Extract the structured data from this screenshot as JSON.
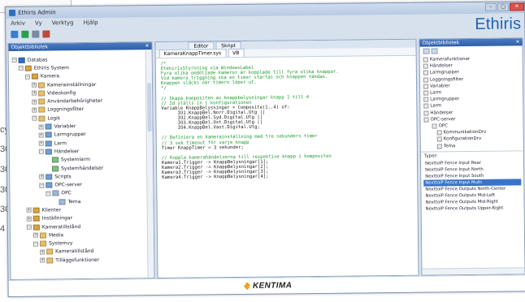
{
  "window": {
    "title": "Ethiris Admin",
    "controls": [
      "–",
      "□",
      "✕"
    ]
  },
  "menu": [
    "Arkiv",
    "Vy",
    "Verktyg",
    "Hjälp"
  ],
  "brand": "Ethiris",
  "background_fragments": [
    "cy",
    "30",
    "30",
    "30",
    "30",
    "4"
  ],
  "left_panel": {
    "header": "Objektbibliotek",
    "tree": [
      {
        "label": "Databas",
        "indent": 0,
        "color": "#2f6fc2",
        "expander": "−"
      },
      {
        "label": "Ethiris System",
        "indent": 1,
        "color": "#d9a441",
        "expander": "−"
      },
      {
        "label": "Kamera",
        "indent": 2,
        "color": "#d9a441",
        "expander": "−"
      },
      {
        "label": "Kamerainställningar",
        "indent": 3,
        "color": "#e9c06a",
        "expander": "+"
      },
      {
        "label": "Videokonfig",
        "indent": 3,
        "color": "#e9c06a",
        "expander": "+"
      },
      {
        "label": "Användarbehörigheter",
        "indent": 3,
        "color": "#e9c06a",
        "expander": "+"
      },
      {
        "label": "Loggningsfilter",
        "indent": 3,
        "color": "#e9c06a",
        "expander": "+"
      },
      {
        "label": "Logik",
        "indent": 3,
        "color": "#e9c06a",
        "expander": "−"
      },
      {
        "label": "Variabler",
        "indent": 4,
        "color": "#6fa0d8",
        "expander": "+"
      },
      {
        "label": "Larmgrupper",
        "indent": 4,
        "color": "#6fa0d8",
        "expander": "+"
      },
      {
        "label": "Larm",
        "indent": 4,
        "color": "#6fa0d8",
        "expander": "+"
      },
      {
        "label": "Händelser",
        "indent": 4,
        "color": "#6fa0d8",
        "expander": "−"
      },
      {
        "label": "Systemlarm",
        "indent": 5,
        "color": "#7fc080",
        "expander": ""
      },
      {
        "label": "Systemhändelser",
        "indent": 5,
        "color": "#7fc080",
        "expander": ""
      },
      {
        "label": "Scripts",
        "indent": 4,
        "color": "#6fa0d8",
        "expander": "+"
      },
      {
        "label": "OPC-server",
        "indent": 4,
        "color": "#6fa0d8",
        "expander": "−"
      },
      {
        "label": "OPC",
        "indent": 5,
        "color": "#9fb7d8",
        "expander": "−"
      },
      {
        "label": "Tema",
        "indent": 6,
        "color": "#9fb7d8",
        "expander": ""
      },
      {
        "label": "Klienter",
        "indent": 2,
        "color": "#d9a441",
        "expander": "+"
      },
      {
        "label": "Inställningar",
        "indent": 2,
        "color": "#d9a441",
        "expander": "+"
      },
      {
        "label": "Kameratillstånd",
        "indent": 2,
        "color": "#d9a441",
        "expander": "−"
      },
      {
        "label": "Media",
        "indent": 3,
        "color": "#e9c06a",
        "expander": "+"
      },
      {
        "label": "Systemvy",
        "indent": 3,
        "color": "#e9c06a",
        "expander": "−"
      },
      {
        "label": "Kameratillstånd",
        "indent": 4,
        "color": "#e9c06a",
        "expander": "+"
      },
      {
        "label": "Tilläggsfunktioner",
        "indent": 4,
        "color": "#e9c06a",
        "expander": "+"
      }
    ]
  },
  "center": {
    "doc_tabs": [
      "Editor",
      "Skript"
    ],
    "file_tabs": [
      "KameraKnappTimer.sys",
      "VB"
    ],
    "code": [
      {
        "t": "/*",
        "c": "g"
      },
      {
        "t": "EtehirisStyrnning via WindowsLabel",
        "c": "g"
      },
      {
        "t": "Fyra olika omdöljade kameror är kopplade till fyra olika knappar.",
        "c": "g"
      },
      {
        "t": "Vid kamera triggning ska en timer startas och knappen tändas.",
        "c": "g"
      },
      {
        "t": "Knappen släcks när timern löper ut.",
        "c": "g"
      },
      {
        "t": "*/",
        "c": "g"
      },
      {
        "t": "",
        "c": "k"
      },
      {
        "t": "// Skapa kompositen av knappbelysningar knapp 1 till 4",
        "c": "g"
      },
      {
        "t": "// Id ställs in i konfigurationen",
        "c": "g"
      },
      {
        "t": "Variable KnappBelysningar = Composite(1..4) of:",
        "c": "k"
      },
      {
        "t": "      IO1.KnappBel.Norr.Digital.Utg ||",
        "c": "k"
      },
      {
        "t": "      IO2.KnappBel.Syd.Digital.Utg ||",
        "c": "k"
      },
      {
        "t": "      IO3.KnappBel.Ost.Digital.Utg ||",
        "c": "k"
      },
      {
        "t": "      IO4.KnappBel.Vast.Digital.Utg;",
        "c": "k"
      },
      {
        "t": "",
        "c": "k"
      },
      {
        "t": "// Definiera en kamerainställning med tre sekunders timer",
        "c": "g"
      },
      {
        "t": "// 3 sek timeout för varje knapp",
        "c": "g"
      },
      {
        "t": "Timer KnappTimer = 3 sekunder;",
        "c": "k"
      },
      {
        "t": "",
        "c": "k"
      },
      {
        "t": "// Koppla kamerahändelserna till respektive knapp i kompositen",
        "c": "g"
      },
      {
        "t": "Kamera1.Trigger -> KnappBelysningar[1];",
        "c": "k"
      },
      {
        "t": "Kamera2.Trigger -> KnappBelysningar[2];",
        "c": "k"
      },
      {
        "t": "Kamera3.Trigger -> KnappBelysningar[3];",
        "c": "k"
      },
      {
        "t": "Kamera4.Trigger -> KnappBelysningar[4];",
        "c": "k"
      }
    ]
  },
  "right_panel": {
    "header": "Objektbibliotek",
    "tree": [
      "Kamerafunktioner",
      "Händelser",
      "Larmgrupper",
      "Loggningsfilter",
      "Variabler",
      "Larm",
      "Larmgrupper",
      "Larm",
      "Händelser",
      "OPC-server",
      "OPC",
      "KommunikationDrv",
      "KonfigurationDrv",
      "Tema"
    ],
    "types_label": "Typer:",
    "types": [
      "NexttoIP Fence Input Rear",
      "NexttoIP Fence Input North",
      "NexttoIP Fence Input South",
      "NexttoIP Fence Input Multi",
      "NexttoIP Fence Outputs North-Center",
      "NexttoIP Fence Outputs Mid-Left",
      "NexttoIP Fence Outputs Mid-Right",
      "NexttoIP Fence Outputs Upper-Right"
    ],
    "selected_type_index": 3
  },
  "footer": {
    "logo_text": "KENTIMA"
  },
  "colors": {
    "accent": "#1d63b3",
    "selection": "#3a74c9",
    "code_comment": "#1a9a2a"
  }
}
